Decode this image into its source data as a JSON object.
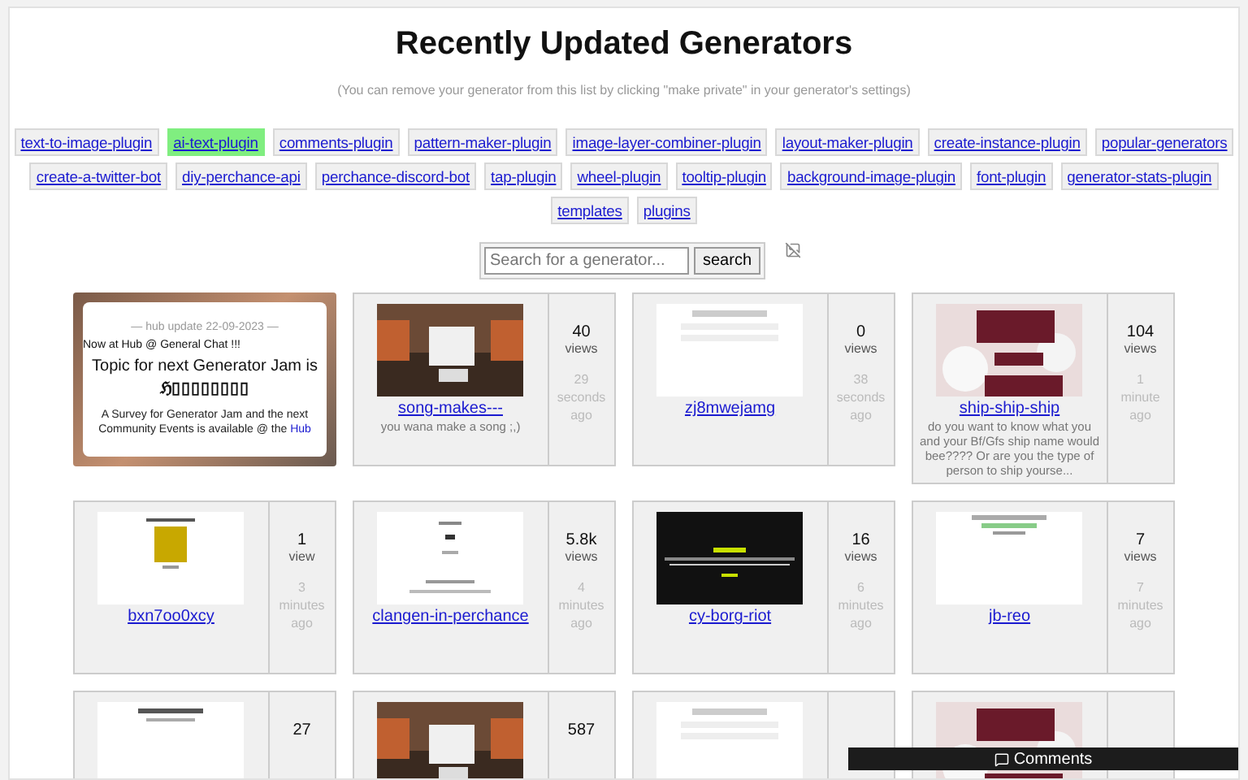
{
  "title": "Recently Updated Generators",
  "note": "(You can remove your generator from this list by clicking \"make private\" in your generator's settings)",
  "tags": [
    {
      "label": "text-to-image-plugin",
      "selected": false
    },
    {
      "label": "ai-text-plugin",
      "selected": true
    },
    {
      "label": "comments-plugin",
      "selected": false
    },
    {
      "label": "pattern-maker-plugin",
      "selected": false
    },
    {
      "label": "image-layer-combiner-plugin",
      "selected": false
    },
    {
      "label": "layout-maker-plugin",
      "selected": false
    },
    {
      "label": "create-instance-plugin",
      "selected": false
    },
    {
      "label": "popular-generators",
      "selected": false
    },
    {
      "label": "create-a-twitter-bot",
      "selected": false
    },
    {
      "label": "diy-perchance-api",
      "selected": false
    },
    {
      "label": "perchance-discord-bot",
      "selected": false
    },
    {
      "label": "tap-plugin",
      "selected": false
    },
    {
      "label": "wheel-plugin",
      "selected": false
    },
    {
      "label": "tooltip-plugin",
      "selected": false
    },
    {
      "label": "background-image-plugin",
      "selected": false
    },
    {
      "label": "font-plugin",
      "selected": false
    },
    {
      "label": "generator-stats-plugin",
      "selected": false
    },
    {
      "label": "templates",
      "selected": false
    },
    {
      "label": "plugins",
      "selected": false
    }
  ],
  "search": {
    "placeholder": "Search for a generator...",
    "button": "search"
  },
  "cards": [
    {
      "kind": "hub",
      "heading": "— hub update 22-09-2023 —",
      "ticker": "Now at Hub @ General Chat !!!",
      "topic": "Topic for next Generator Jam is",
      "topic_name": "ℌ▯▯▯▯▯▯▯▯",
      "text": "A Survey for Generator Jam and the next Community Events is available @ the",
      "link": "Hub"
    },
    {
      "kind": "generator",
      "name": "song-makes---",
      "description": "you wana make a song ;,)",
      "count": "40",
      "unit": "views",
      "time": "29",
      "time_unit": "seconds",
      "ago": "ago"
    },
    {
      "kind": "generator",
      "name": "zj8mwejamg",
      "count": "0",
      "unit": "views",
      "time": "38",
      "time_unit": "seconds",
      "ago": "ago"
    },
    {
      "kind": "generator",
      "name": "ship-ship-ship",
      "description": "do you want to know what you and your Bf/Gfs ship name would bee???? Or are you the type of person to ship yourse...",
      "count": "104",
      "unit": "views",
      "time": "1",
      "time_unit": "minute",
      "ago": "ago"
    },
    {
      "kind": "generator",
      "name": "bxn7oo0xcy",
      "count": "1",
      "unit": "view",
      "time": "3",
      "time_unit": "minutes",
      "ago": "ago"
    },
    {
      "kind": "generator",
      "name": "clangen-in-perchance",
      "count": "5.8k",
      "unit": "views",
      "time": "4",
      "time_unit": "minutes",
      "ago": "ago"
    },
    {
      "kind": "generator",
      "name": "cy-borg-riot",
      "count": "16",
      "unit": "views",
      "time": "6",
      "time_unit": "minutes",
      "ago": "ago"
    },
    {
      "kind": "generator",
      "name": "jb-reo",
      "count": "7",
      "unit": "views",
      "time": "7",
      "time_unit": "minutes",
      "ago": "ago"
    },
    {
      "kind": "generator",
      "count": "27"
    },
    {
      "kind": "generator",
      "count": "587"
    },
    {
      "kind": "generator"
    },
    {
      "kind": "generator"
    }
  ],
  "comments": {
    "label": "Comments"
  }
}
